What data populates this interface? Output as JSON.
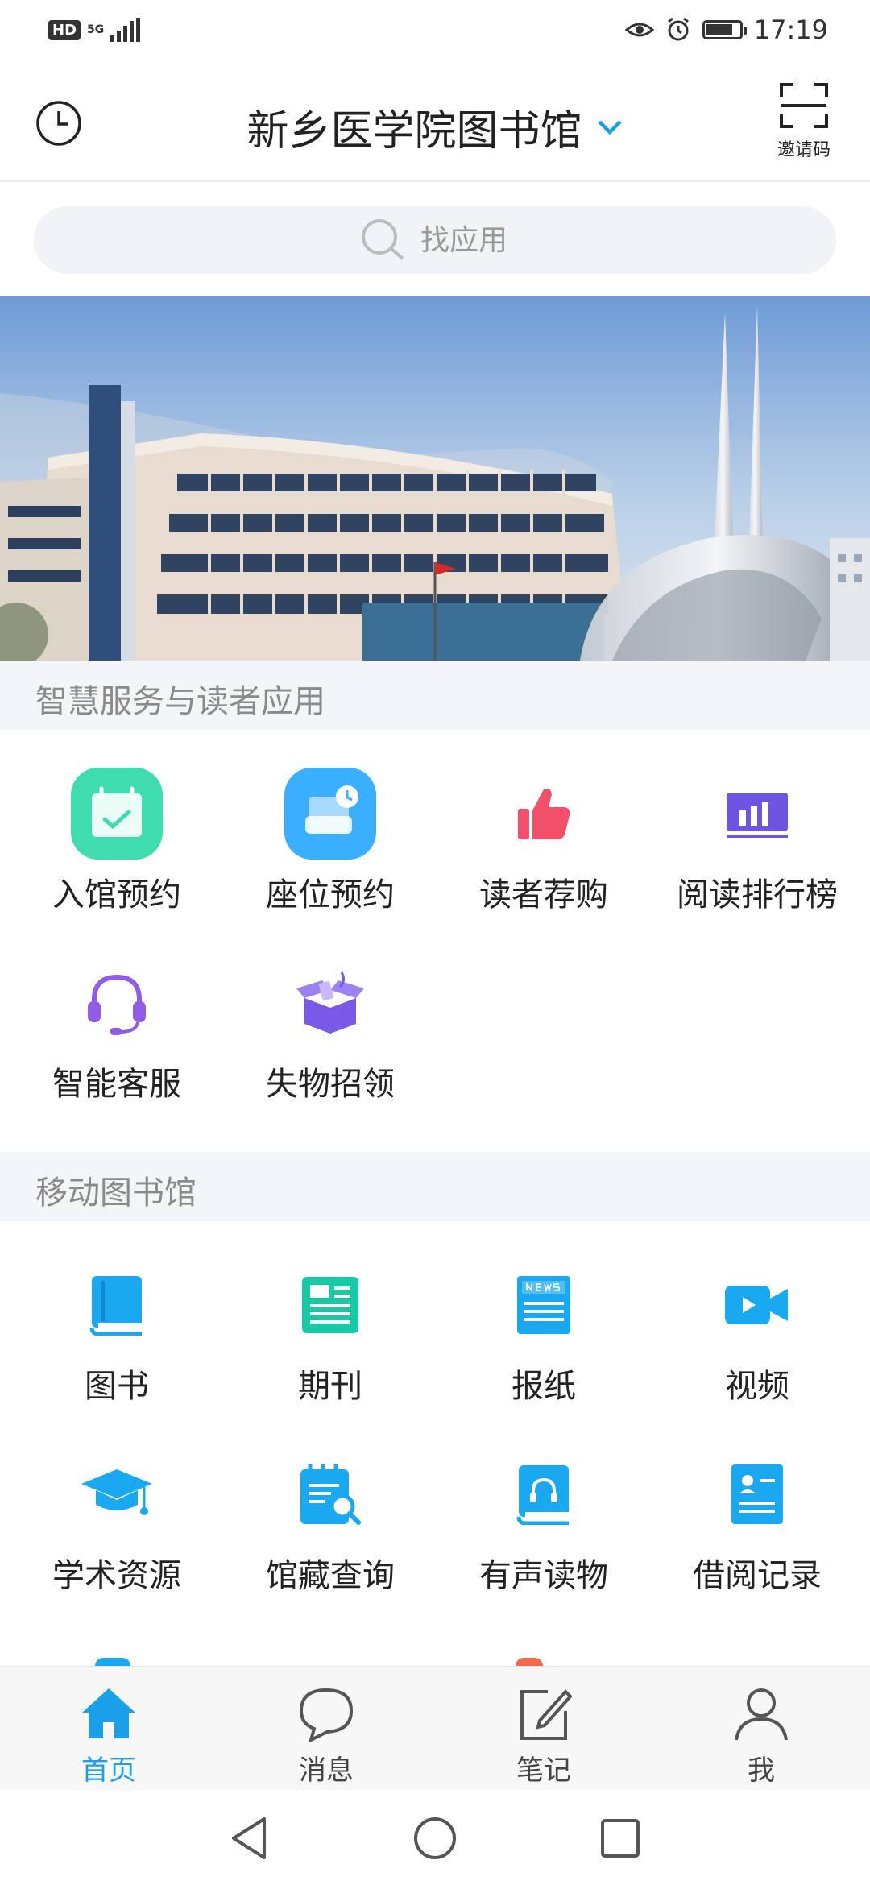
{
  "status_bar": {
    "network_badge": "HD",
    "network_type": "5G",
    "time": "17:19",
    "icons": [
      "eye-icon",
      "alarm-icon",
      "battery-icon"
    ],
    "battery_level": 0.8
  },
  "header": {
    "title": "新乡医学院图书馆",
    "history_icon": "clock-icon",
    "dropdown_icon": "chevron-down-icon",
    "invite_label": "邀请码",
    "invite_icon": "scan-frame-icon",
    "accent_color": "#1aa0e8"
  },
  "search": {
    "placeholder": "找应用",
    "icon": "search-icon"
  },
  "banner": {
    "alt": "library-building-photo"
  },
  "sections": [
    {
      "title": "智慧服务与读者应用",
      "items": [
        {
          "label": "入馆预约",
          "icon": "calendar-check-icon",
          "color": "#3fdcb0"
        },
        {
          "label": "座位预约",
          "icon": "seat-clock-icon",
          "color": "#3aaeff"
        },
        {
          "label": "读者荐购",
          "icon": "thumbs-up-icon",
          "color": "#f2506a"
        },
        {
          "label": "阅读排行榜",
          "icon": "bar-chart-icon",
          "color": "#6e55e0"
        },
        {
          "label": "智能客服",
          "icon": "headset-icon",
          "color": "#8e5ce6"
        },
        {
          "label": "失物招领",
          "icon": "open-box-icon",
          "color": "#7a58e8"
        }
      ]
    },
    {
      "title": "移动图书馆",
      "items": [
        {
          "label": "图书",
          "icon": "book-icon",
          "color": "#1aa9f0"
        },
        {
          "label": "期刊",
          "icon": "journal-icon",
          "color": "#18c9a6"
        },
        {
          "label": "报纸",
          "icon": "newspaper-icon",
          "color": "#1aa9f0"
        },
        {
          "label": "视频",
          "icon": "video-camera-icon",
          "color": "#1aa9f0"
        },
        {
          "label": "学术资源",
          "icon": "graduation-cap-icon",
          "color": "#1aa9f0"
        },
        {
          "label": "馆藏查询",
          "icon": "clipboard-search-icon",
          "color": "#1aa9f0"
        },
        {
          "label": "有声读物",
          "icon": "audio-book-icon",
          "color": "#1aa9f0"
        },
        {
          "label": "借阅记录",
          "icon": "id-card-icon",
          "color": "#1aa9f0"
        }
      ]
    }
  ],
  "bottom_nav": [
    {
      "label": "首页",
      "icon": "home-icon",
      "active": true
    },
    {
      "label": "消息",
      "icon": "chat-bubble-icon",
      "active": false
    },
    {
      "label": "笔记",
      "icon": "edit-note-icon",
      "active": false
    },
    {
      "label": "我",
      "icon": "user-icon",
      "active": false
    }
  ],
  "system_nav": [
    "back-icon",
    "home-circle-icon",
    "recents-icon"
  ]
}
